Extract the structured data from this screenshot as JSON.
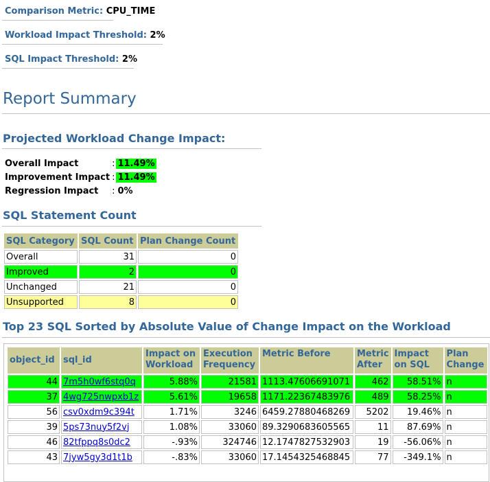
{
  "params": {
    "metric_label": "Comparison Metric:",
    "metric_value": "CPU_TIME",
    "workload_label": "Workload Impact Threshold:",
    "workload_value": "2%",
    "sql_label": "SQL Impact Threshold:",
    "sql_value": "2%"
  },
  "report_title": "Report Summary",
  "impact": {
    "heading": "Projected Workload Change Impact:",
    "overall_label": "Overall Impact",
    "overall_value": "11.49%",
    "improvement_label": "Improvement Impact",
    "improvement_value": "11.49%",
    "regression_label": "Regression Impact",
    "regression_value": "0%",
    "sep": ":"
  },
  "count": {
    "heading": "SQL Statement Count",
    "headers": [
      "SQL Category",
      "SQL Count",
      "Plan Change Count"
    ],
    "rows": [
      [
        "Overall",
        "31",
        "0"
      ],
      [
        "Improved",
        "2",
        "0"
      ],
      [
        "Unchanged",
        "21",
        "0"
      ],
      [
        "Unsupported",
        "8",
        "0"
      ]
    ]
  },
  "top": {
    "heading": "Top 23 SQL Sorted by Absolute Value of Change Impact on the Workload",
    "headers": [
      "object_id",
      "sql_id",
      "Impact on Workload",
      "Execution Frequency",
      "Metric Before",
      "Metric After",
      "Impact on SQL",
      "Plan Change"
    ],
    "rows": [
      [
        "44",
        "7m5h0wf6stq0q",
        "5.88%",
        "21581",
        "1113.47606691071",
        "462",
        "58.51%",
        "n"
      ],
      [
        "37",
        "4wg725nwpxb1z",
        "5.61%",
        "19658",
        "1171.22367483976",
        "489",
        "58.25%",
        "n"
      ],
      [
        "56",
        "csv0xdm9c394t",
        "1.71%",
        "3246",
        "6459.27880468269",
        "5202",
        "19.46%",
        "n"
      ],
      [
        "39",
        "5ps73nuy5f2vj",
        "1.08%",
        "33060",
        "89.3290683605565",
        "11",
        "87.69%",
        "n"
      ],
      [
        "46",
        "82tfppq8s0dc2",
        "-.93%",
        "324746",
        "12.1747827532903",
        "19",
        "-56.06%",
        "n"
      ],
      [
        "43",
        "7jyw5gy3d1t1b",
        "-.83%",
        "33060",
        "17.1454325468845",
        "77",
        "-349.1%",
        "n"
      ]
    ]
  },
  "colors": {
    "accent": "#336699",
    "improved": "#00ff00",
    "unsupported": "#ffff99",
    "header": "#cccc99"
  }
}
